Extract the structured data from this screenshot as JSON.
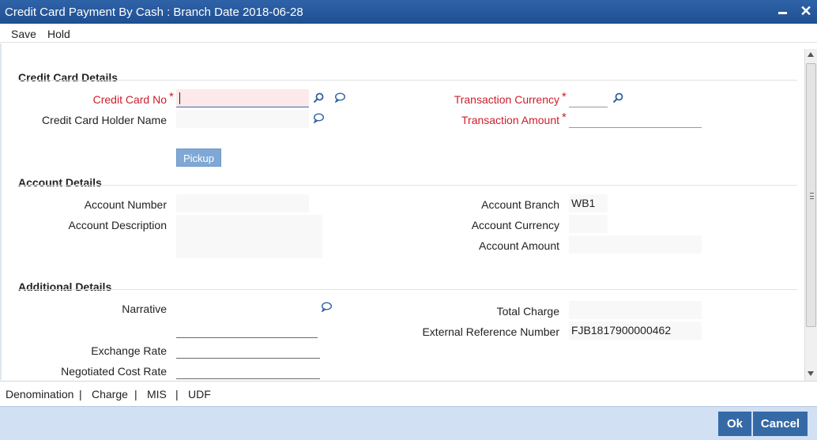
{
  "window": {
    "title": "Credit Card Payment By Cash : Branch Date 2018-06-28",
    "minimize_label": "",
    "close_label": "✕"
  },
  "menu": {
    "save": "Save",
    "hold": "Hold"
  },
  "sections": {
    "credit_card": "Credit Card Details",
    "account": "Account Details",
    "additional": "Additional Details"
  },
  "credit_card": {
    "card_no_label": "Credit Card No",
    "card_no_value": "",
    "holder_name_label": "Credit Card Holder Name",
    "holder_name_value": "",
    "txn_currency_label": "Transaction Currency",
    "txn_currency_value": "",
    "txn_amount_label": "Transaction Amount",
    "txn_amount_value": "",
    "required_mark": "*",
    "pickup_label": "Pickup"
  },
  "account": {
    "number_label": "Account Number",
    "number_value": "",
    "description_label": "Account Description",
    "description_value": "",
    "branch_label": "Account Branch",
    "branch_value": "WB1",
    "currency_label": "Account Currency",
    "currency_value": "",
    "amount_label": "Account Amount",
    "amount_value": ""
  },
  "additional": {
    "narrative_label": "Narrative",
    "narrative_value": "",
    "exchange_rate_label": "Exchange Rate",
    "exchange_rate_value": "",
    "negotiated_cost_rate_label": "Negotiated Cost Rate",
    "negotiated_cost_rate_value": "",
    "total_charge_label": "Total Charge",
    "total_charge_value": "",
    "ext_ref_label": "External Reference Number",
    "ext_ref_value": "FJB1817900000462"
  },
  "bottom_tabs": {
    "denomination": "Denomination",
    "charge": "Charge",
    "mis": "MIS",
    "udf": "UDF",
    "separator": "|"
  },
  "footer": {
    "ok": "Ok",
    "cancel": "Cancel"
  },
  "colors": {
    "titlebar": "#2a5c9e",
    "required": "#cc1e2b",
    "button": "#356aa7",
    "footer_bg": "#d1e1f3"
  }
}
